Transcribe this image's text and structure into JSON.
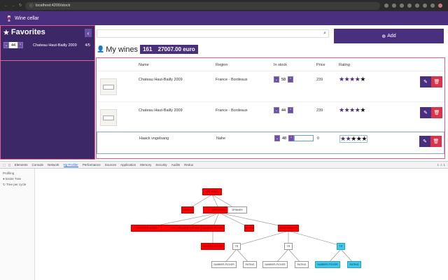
{
  "browser": {
    "url": "localhost:4200/stock"
  },
  "app": {
    "title": "Wine cellar"
  },
  "sidebar": {
    "title": "Favorites",
    "collapse_icon": "‹",
    "favorites": [
      {
        "qty": "44",
        "name": "Chateau Haut-Bailly 2009",
        "ratio": "4/5"
      }
    ]
  },
  "toolbar": {
    "add_label": "Add",
    "search_placeholder": ""
  },
  "mywines": {
    "title": "My wines",
    "count": "161",
    "total": "27007.00 euro"
  },
  "table": {
    "headers": {
      "name": "Name",
      "region": "Region",
      "stock": "In stock",
      "price": "Price",
      "rating": "Rating"
    },
    "rows": [
      {
        "name": "Chateau Haut-Bailly 2009",
        "region": "France - Bordeaux",
        "stock": "58",
        "price": "239",
        "rating": 4,
        "selected": false
      },
      {
        "name": "Chateau Haut-Bailly 2009",
        "region": "France - Bordeaux",
        "stock": "44",
        "price": "239",
        "rating": 4,
        "selected": false
      },
      {
        "name": "Haack vogelsang",
        "region": "Nahe",
        "stock": "48",
        "price": "0",
        "rating": 2,
        "selected": true
      }
    ]
  },
  "devtools": {
    "tabs": [
      "Elements",
      "Console",
      "Network",
      "Ng Profiler",
      "Performance",
      "Sources",
      "Application",
      "Memory",
      "Security",
      "Audits",
      "Redux"
    ],
    "active_tab": "Ng Profiler",
    "right_info": "1 ⚠ 1",
    "profiler": {
      "title": "Profiling",
      "options": [
        "Entire Tree",
        "Tree per cycle"
      ]
    },
    "tree_nodes": [
      {
        "label": "APP-ROOT",
        "color": "red"
      },
      {
        "label": "NAVBAR",
        "color": "red"
      },
      {
        "label": "APP-STOCK",
        "color": "red"
      },
      {
        "label": "SPINNER",
        "color": "none"
      },
      {
        "label": "FAVORITE-WINES",
        "color": "red"
      },
      {
        "label": "COLLAPSABLE-SIDEBAR",
        "color": "red"
      },
      {
        "label": "NUMBER-PICKER",
        "color": "red"
      },
      {
        "label": "SEARCH",
        "color": "red"
      },
      {
        "label": "WINE-RESULTS",
        "color": "red"
      },
      {
        "label": "NUMBER-PICKER",
        "color": "red"
      },
      {
        "label": "TR",
        "color": "none"
      },
      {
        "label": "TR",
        "color": "none"
      },
      {
        "label": "TR",
        "color": "blue"
      },
      {
        "label": "NUMBER-PICKER",
        "color": "none"
      },
      {
        "label": "RATING",
        "color": "none"
      },
      {
        "label": "NUMBER-PICKER",
        "color": "none"
      },
      {
        "label": "RATING",
        "color": "none"
      },
      {
        "label": "NUMBER-PICKER",
        "color": "blue"
      },
      {
        "label": "RATING",
        "color": "blue"
      }
    ]
  },
  "colors": {
    "brand": "#4b2f7f",
    "sidebar": "#3d2867",
    "danger": "#d9344a",
    "highlight_red": "#ff0000",
    "highlight_blue": "#40c8f0"
  }
}
